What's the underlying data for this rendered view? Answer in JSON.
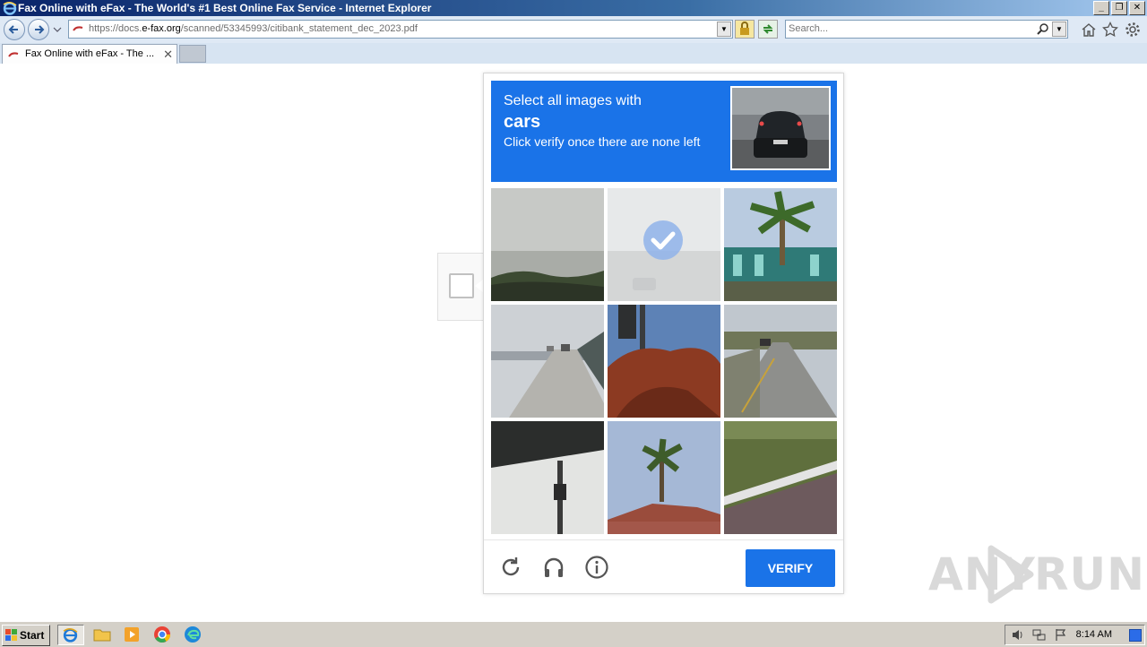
{
  "window": {
    "title": "Fax Online with eFax - The World's #1 Best Online Fax Service - Internet Explorer",
    "controls": [
      "_",
      "❐",
      "✕"
    ]
  },
  "address_bar": {
    "url_prefix": "https://docs.",
    "url_domain": "e-fax.org",
    "url_path": "/scanned/53345993/citibank_statement_dec_2023.pdf"
  },
  "search_box": {
    "placeholder": "Search..."
  },
  "tabs": [
    {
      "label": "Fax Online with eFax - The ...",
      "close": "✕"
    }
  ],
  "captcha": {
    "prompt_line1": "Select all images with",
    "prompt_target": "cars",
    "prompt_line3": "Click verify once there are none left",
    "tiles": [
      {
        "name": "tile-sky-trees",
        "selected": false
      },
      {
        "name": "tile-street-car",
        "selected": true
      },
      {
        "name": "tile-palm-building",
        "selected": false
      },
      {
        "name": "tile-highway-cars",
        "selected": false
      },
      {
        "name": "tile-traffic-light-tree",
        "selected": false
      },
      {
        "name": "tile-road-cars",
        "selected": false
      },
      {
        "name": "tile-overpass-pole",
        "selected": false
      },
      {
        "name": "tile-palm-roof",
        "selected": false
      },
      {
        "name": "tile-guardrail-hedge",
        "selected": false
      }
    ],
    "verify_label": "VERIFY"
  },
  "watermark": {
    "left": "ANY",
    "right": "RUN"
  },
  "taskbar": {
    "start_label": "Start",
    "clock": "8:14 AM"
  },
  "colors": {
    "accent": "#1a73e8",
    "title_bar": "#0a246a"
  }
}
